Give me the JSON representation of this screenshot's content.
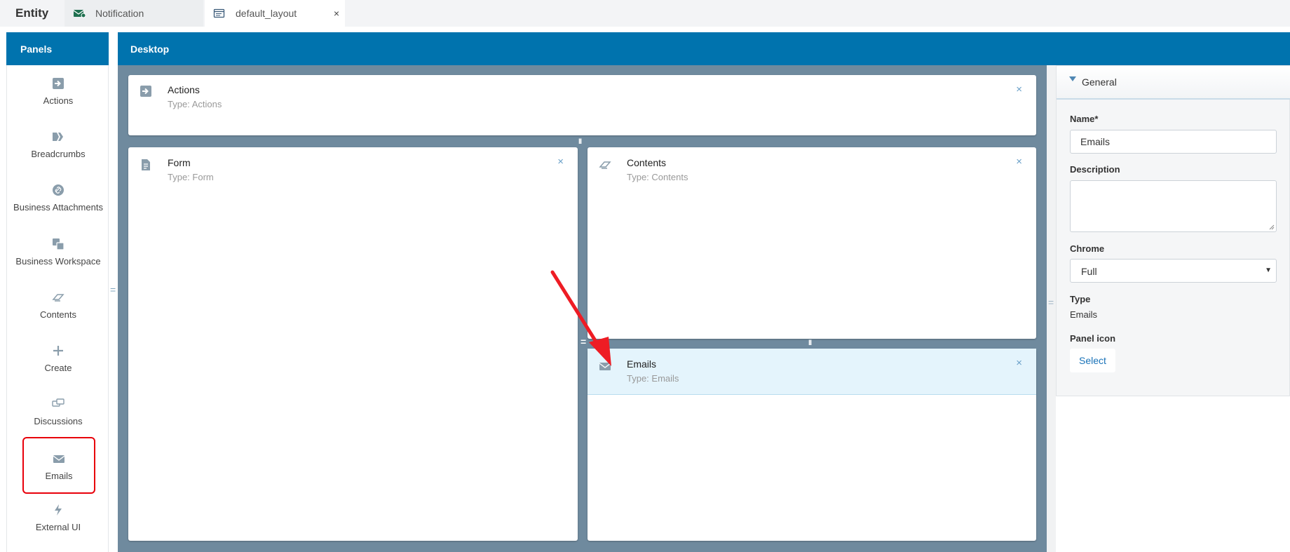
{
  "topbar": {
    "app_title": "Entity",
    "tabs": [
      {
        "label": "Notification",
        "icon": "notification-envelope-icon"
      },
      {
        "label": "default_layout",
        "icon": "layout-icon",
        "close": "×"
      }
    ]
  },
  "left_panel": {
    "title": "Panels",
    "items": [
      {
        "label": "Actions",
        "icon": "arrow-right-icon"
      },
      {
        "label": "Breadcrumbs",
        "icon": "breadcrumbs-icon"
      },
      {
        "label": "Business Attachments",
        "icon": "link-icon"
      },
      {
        "label": "Business Workspace",
        "icon": "workspace-icon"
      },
      {
        "label": "Contents",
        "icon": "contents-icon"
      },
      {
        "label": "Create",
        "icon": "plus-icon"
      },
      {
        "label": "Discussions",
        "icon": "discussions-icon"
      },
      {
        "label": "Emails",
        "icon": "envelope-icon"
      },
      {
        "label": "External UI",
        "icon": "lightning-icon"
      }
    ]
  },
  "desktop": {
    "title": "Desktop",
    "cards": [
      {
        "title": "Actions",
        "type": "Type: Actions",
        "icon": "arrow-right-icon"
      },
      {
        "title": "Form",
        "type": "Type: Form",
        "icon": "form-icon"
      },
      {
        "title": "Contents",
        "type": "Type: Contents",
        "icon": "contents-icon"
      },
      {
        "title": "Emails",
        "type": "Type: Emails",
        "icon": "envelope-icon"
      }
    ],
    "close_glyph": "×"
  },
  "properties": {
    "section_title": "General",
    "name_label": "Name*",
    "name_value": "Emails",
    "description_label": "Description",
    "description_value": "",
    "chrome_label": "Chrome",
    "chrome_value": "Full",
    "type_label": "Type",
    "type_value": "Emails",
    "panel_icon_label": "Panel icon",
    "select_button": "Select"
  },
  "colors": {
    "header_blue": "#0073ae",
    "desk_bg": "#6f8a9e",
    "icon_gray": "#8a9dab",
    "highlight_red": "#e8000b",
    "link_blue": "#1a73b8"
  }
}
